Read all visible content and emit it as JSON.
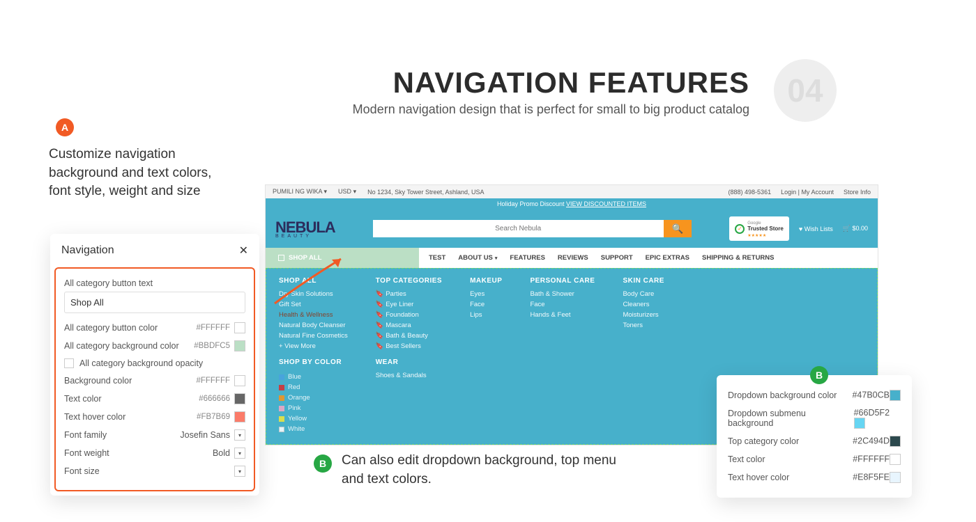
{
  "header": {
    "title": "NAVIGATION FEATURES",
    "subtitle": "Modern navigation design that is perfect for small to big product catalog",
    "number": "04"
  },
  "badge_a": "A",
  "desc_a_1": "Customize navigation",
  "desc_a_2": "background and text colors,",
  "desc_a_3": "font style, weight and size",
  "nav_panel": {
    "title": "Navigation",
    "rows": {
      "r0": {
        "label": "All category button text",
        "value": "Shop All"
      },
      "r1": {
        "label": "All category button color",
        "hex": "#FFFFFF",
        "swatch": "#ffffff"
      },
      "r2": {
        "label": "All category background color",
        "hex": "#BBDFC5",
        "swatch": "#bbdfc5"
      },
      "r3": {
        "label": "All category background opacity"
      },
      "r4": {
        "label": "Background color",
        "hex": "#FFFFFF",
        "swatch": "#ffffff"
      },
      "r5": {
        "label": "Text color",
        "hex": "#666666",
        "swatch": "#666666"
      },
      "r6": {
        "label": "Text hover color",
        "hex": "#FB7B69",
        "swatch": "#fb7b69"
      },
      "r7": {
        "label": "Font family",
        "value": "Josefin Sans"
      },
      "r8": {
        "label": "Font weight",
        "value": "Bold"
      },
      "r9": {
        "label": "Font size",
        "value": ""
      }
    }
  },
  "site": {
    "topbar": {
      "lang": "PUMILI NG WIKA",
      "currency": "USD",
      "address": "No 1234, Sky Tower Street, Ashland, USA",
      "phone": "(888) 498-5361",
      "account": "Login | My Account",
      "storeinfo": "Store Info"
    },
    "promo": "Holiday Promo Discount ",
    "promo_link": "VIEW DISCOUNTED ITEMS",
    "logo": "NEBULA",
    "logo_sub": "BEAUTY",
    "search_placeholder": "Search Nebula",
    "trust": "Trusted Store",
    "wish": "Wish Lists",
    "cart": "$0.00",
    "shop_all": "SHOP ALL",
    "nav": [
      "TEST",
      "ABOUT US",
      "FEATURES",
      "REVIEWS",
      "SUPPORT",
      "EPIC EXTRAS",
      "SHIPPING & RETURNS"
    ],
    "mega": {
      "c0": {
        "title": "SHOP ALL",
        "items": [
          "Dry Skin Solutions",
          "Gift Set",
          "Health & Wellness",
          "Natural Body Cleanser",
          "Natural Fine Cosmetics",
          "+ View More"
        ],
        "hl_index": 2,
        "subtitle": "SHOP BY COLOR",
        "colors": [
          [
            "#4aa3df",
            "Blue"
          ],
          [
            "#d93030",
            "Red"
          ],
          [
            "#f7941e",
            "Orange"
          ],
          [
            "#f5a6c4",
            "Pink"
          ],
          [
            "#f2e63d",
            "Yellow"
          ],
          [
            "#ffffff",
            "White"
          ]
        ]
      },
      "c1": {
        "title": "TOP CATEGORIES",
        "items": [
          "Parties",
          "Eye Liner",
          "Foundation",
          "Mascara",
          "Bath & Beauty",
          "Best Sellers"
        ],
        "subtitle": "WEAR",
        "sub_items": [
          "Shoes & Sandals"
        ]
      },
      "c2": {
        "title": "MAKEUP",
        "items": [
          "Eyes",
          "Face",
          "Lips"
        ]
      },
      "c3": {
        "title": "PERSONAL CARE",
        "items": [
          "Bath & Shower",
          "Face",
          "Hands & Feet"
        ]
      },
      "c4": {
        "title": "SKIN CARE",
        "items": [
          "Body Care",
          "Cleaners",
          "Moisturizers",
          "Toners"
        ]
      }
    }
  },
  "badge_b": "B",
  "desc_b_1": "Can also edit dropdown background, top menu",
  "desc_b_2": "and text colors.",
  "panel_b": {
    "rows": [
      {
        "label": "Dropdown background color",
        "hex": "#47B0CB",
        "swatch": "#47b0cb"
      },
      {
        "label": "Dropdown submenu background",
        "hex": "#66D5F2",
        "swatch": "#66d5f2"
      },
      {
        "label": "Top category color",
        "hex": "#2C494D",
        "swatch": "#2c494d"
      },
      {
        "label": "Text color",
        "hex": "#FFFFFF",
        "swatch": "#ffffff"
      },
      {
        "label": "Text hover color",
        "hex": "#E8F5FE",
        "swatch": "#e8f5fe"
      }
    ]
  }
}
